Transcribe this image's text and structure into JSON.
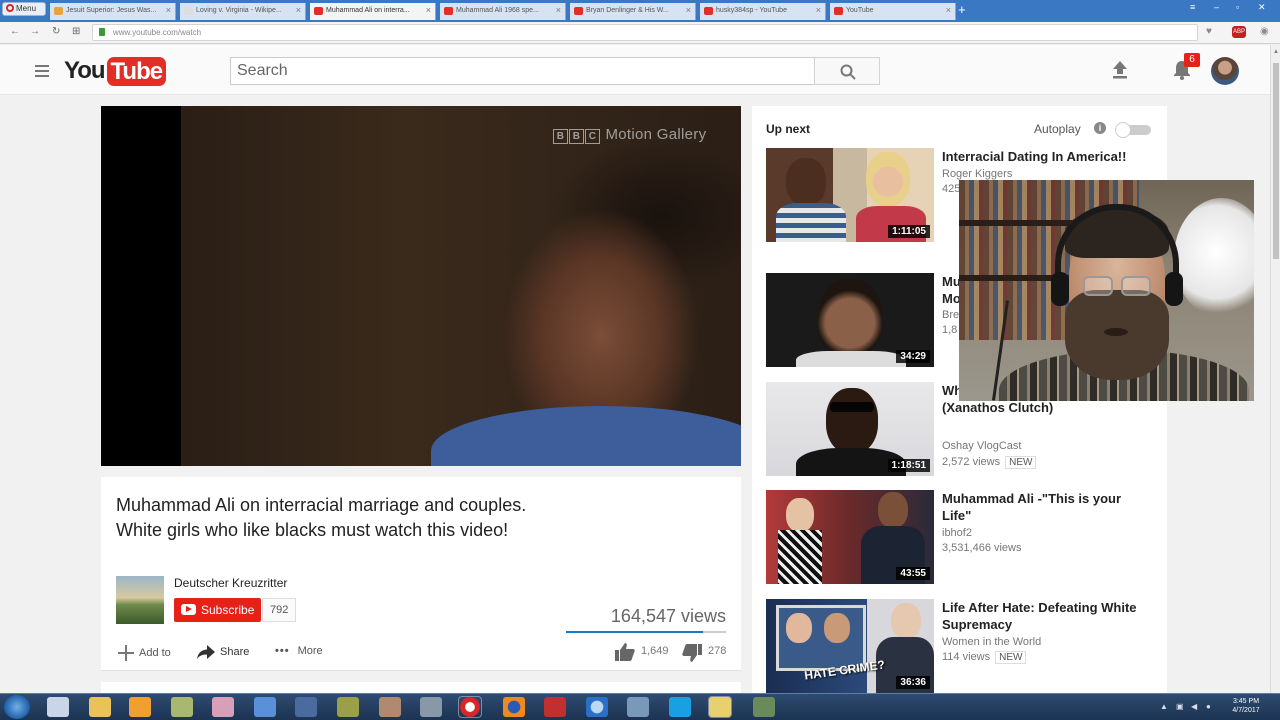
{
  "browser": {
    "menu_label": "Menu",
    "tabs": [
      {
        "label": "Jesuit Superior: Jesus Was...",
        "fav": "#e8a33b",
        "active": false
      },
      {
        "label": "Loving v. Virginia - Wikipe...",
        "fav": "#dddddd",
        "active": false
      },
      {
        "label": "Muhammad Ali on interra...",
        "fav": "#e52d27",
        "active": true
      },
      {
        "label": "Muhammad Ali 1968 spe...",
        "fav": "#e52d27",
        "active": false
      },
      {
        "label": "Bryan Denlinger & His W...",
        "fav": "#e52d27",
        "active": false
      },
      {
        "label": "husky384sp - YouTube",
        "fav": "#e52d27",
        "active": false
      },
      {
        "label": "YouTube",
        "fav": "#e52d27",
        "active": false
      }
    ],
    "url": "www.youtube.com/watch",
    "extension_badge": "ABP"
  },
  "header": {
    "logo_you": "You",
    "logo_tube": "Tube",
    "search_placeholder": "Search",
    "notification_count": "6"
  },
  "player": {
    "watermark": "Motion Gallery",
    "watermark_letters": [
      "B",
      "B",
      "C"
    ]
  },
  "video": {
    "title": "Muhammad Ali on interracial marriage and couples. White girls who like blacks must watch this video!",
    "channel": "Deutscher Kreuzritter",
    "subscribe_label": "Subscribe",
    "subscriber_count": "792",
    "views": "164,547 views",
    "likes": "1,649",
    "dislikes": "278",
    "like_ratio": 0.856,
    "actions": {
      "add_to": "Add to",
      "share": "Share",
      "more": "More"
    }
  },
  "sidebar": {
    "up_next": "Up next",
    "autoplay": "Autoplay",
    "recommendations": [
      {
        "title": "Interracial Dating In America!!",
        "channel": "Roger Kiggers",
        "views": "425",
        "duration": "1:11:05",
        "is_new": false
      },
      {
        "title": "Mu... Mo...",
        "channel": "Bre...",
        "views": "1,8...",
        "duration": "34:29",
        "is_new": false
      },
      {
        "title": "Wh... Man Is Considered White (Xanathos Clutch)",
        "channel": "Oshay VlogCast",
        "views": "2,572 views",
        "duration": "1:18:51",
        "is_new": true
      },
      {
        "title": "Muhammad Ali -\"This is your Life\"",
        "channel": "ibhof2",
        "views": "3,531,466 views",
        "duration": "43:55",
        "is_new": false
      },
      {
        "title": "Life After Hate: Defeating White Supremacy",
        "channel": "Women in the World",
        "views": "114 views",
        "duration": "36:36",
        "is_new": true
      }
    ],
    "new_label": "NEW",
    "thumb_caption": "HATE CRIME?"
  },
  "taskbar": {
    "time": "3:45 PM",
    "date": "4/7/2017"
  }
}
